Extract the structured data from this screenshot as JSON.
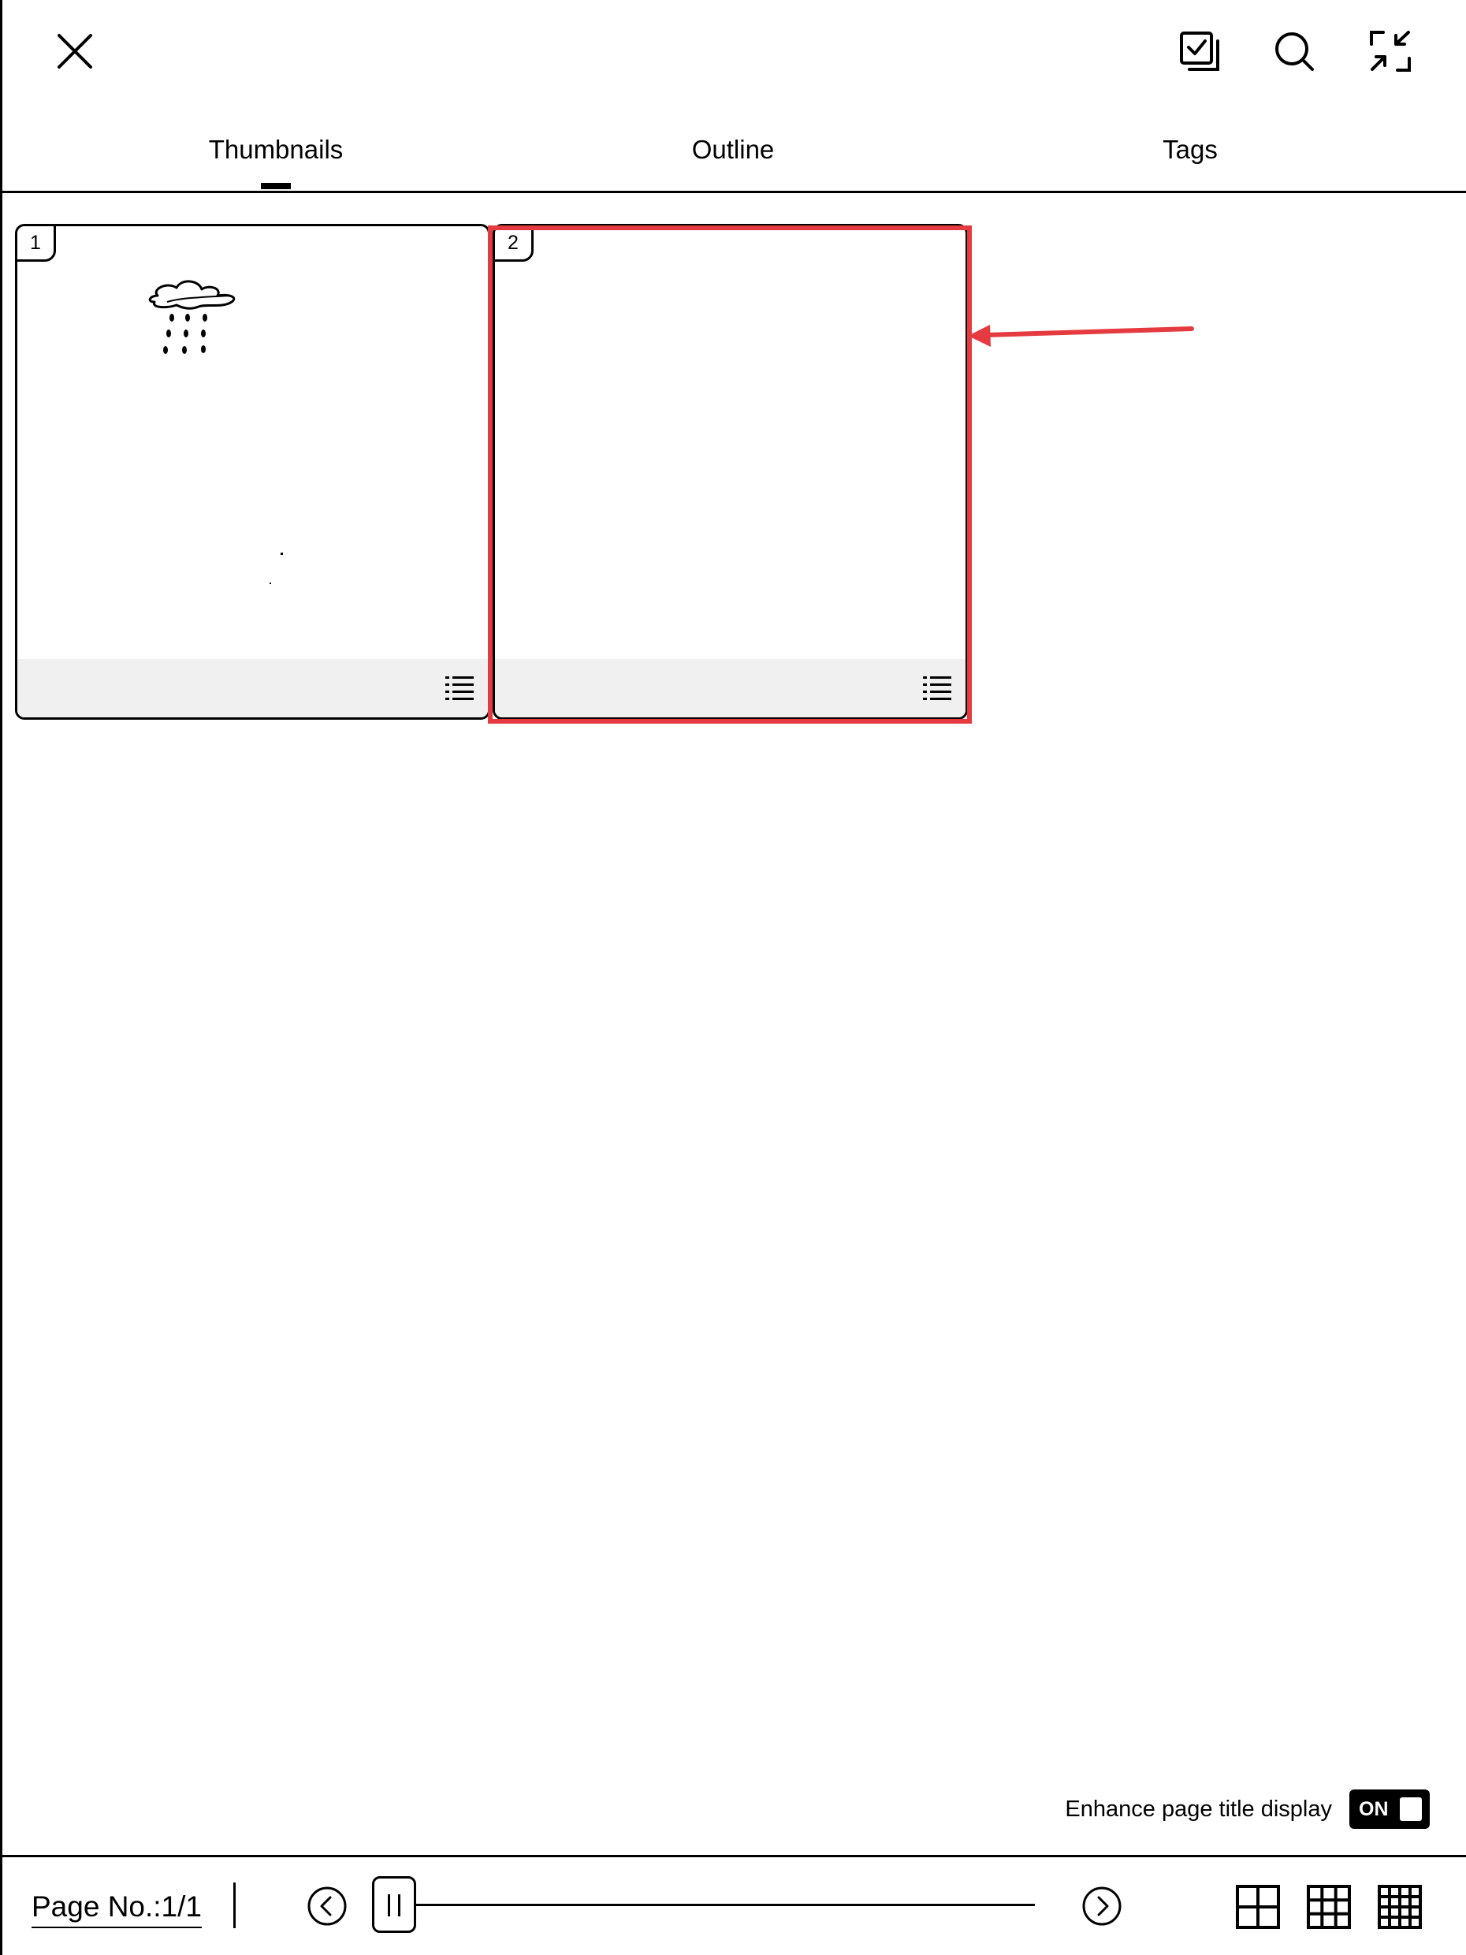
{
  "tabs": {
    "thumbnails": "Thumbnails",
    "outline": "Outline",
    "tags": "Tags",
    "active": "thumbnails"
  },
  "toolbar": {
    "close_icon": "close-icon",
    "select_icon": "multi-select-icon",
    "search_icon": "search-icon",
    "collapse_icon": "collapse-icon"
  },
  "thumbnails": [
    {
      "page_number": "1",
      "has_drawing": true
    },
    {
      "page_number": "2",
      "has_drawing": false
    }
  ],
  "annotation": {
    "highlight_color": "#e53a3f"
  },
  "footer": {
    "enhance_label": "Enhance page title display",
    "toggle_label": "ON",
    "page_no": "Page No.:1/1",
    "grid_options": [
      "grid-2x2-icon",
      "grid-3x3-icon",
      "grid-4x4-icon"
    ]
  }
}
